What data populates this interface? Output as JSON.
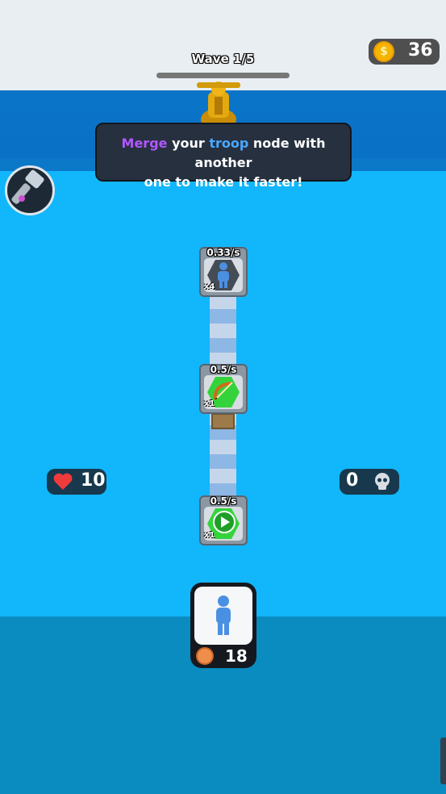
{
  "hud": {
    "wave_label": "Wave 1/5",
    "wave_progress": 0,
    "coins": "36"
  },
  "tutorial": {
    "word_merge": "Merge",
    "text_1": " your ",
    "word_troop": "troop",
    "text_2": " node with another",
    "line_2": "one to make it faster!"
  },
  "nodes": [
    {
      "rate": "0.33/s",
      "multiplier": "x4",
      "icon": "troop-icon"
    },
    {
      "rate": "0.5/s",
      "multiplier": "x1",
      "icon": "bow-icon"
    },
    {
      "rate": "0.5/s",
      "multiplier": "x1",
      "icon": "play-icon"
    }
  ],
  "stats": {
    "lives": "10",
    "kills": "0"
  },
  "spawn": {
    "cost": "18",
    "icon": "troop-icon"
  },
  "colors": {
    "sky": "#e9eef3",
    "wall": "#0a74c8",
    "field": "#11b6fb",
    "lower_field": "#0a8cc0",
    "tooltip_bg": "#26303f",
    "merge_purple": "#b157ff",
    "troop_blue": "#4aa8ff",
    "coin_gold": "#f4b400",
    "node_green": "#35d33b",
    "heart_red": "#ef3b3b"
  }
}
